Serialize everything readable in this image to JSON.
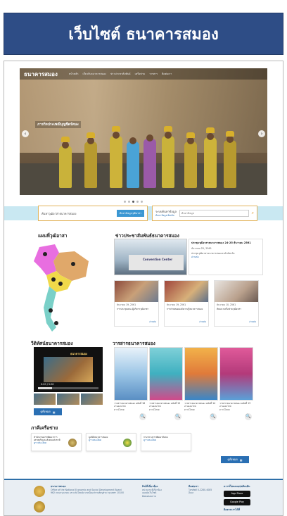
{
  "page_title": "เว็บไซต์ ธนาคารสมอง",
  "site": {
    "logo": "ธนาคารสมอง",
    "nav": [
      "หน้าหลัก",
      "เกี่ยวกับธนาคารสมอง",
      "ข่าวประชาสัมพันธ์",
      "เครือข่าย",
      "วารสาร",
      "ติดต่อเรา"
    ]
  },
  "hero": {
    "caption": "ภารกิจประเพณีบุญซีดรัตนะ",
    "prev": "‹",
    "next": "›"
  },
  "search": {
    "expert_label": "ค้นหาวุฒิอาสาธนาคารสมอง",
    "expert_button": "ค้นหาข้อมูลวุฒิอาสา",
    "db_label": "ระบบค้นหาข้อมูล",
    "db_link": "ค้นหาข้อมูลเพิ่มเติม",
    "db_placeholder": "ค้นหาข้อมูล"
  },
  "sections": {
    "map": "แผนที่วุฒิอาสา",
    "news": "ข่าวประชาสัมพันธ์ธนาคารสมอง",
    "video": "วีดิทัศน์ธนาคารสมอง",
    "journal": "วารสารธนาคารสมอง",
    "partners": "ภาคีเครือข่าย"
  },
  "news": {
    "main": {
      "title": "ประชุมวุฒิอาสาธนาคารสมอง 24-25 ธันวาคม 2561",
      "date": "ธันวาคม 25, 2561",
      "summary": "ประชุมวุฒิอาสาธนาคารสมองระดับจังหวัด",
      "more": "อ่านต่อ"
    },
    "items": [
      {
        "date": "ธันวาคม 19, 2561",
        "title": "การประชุมคณะผู้บริหารวุฒิอาสา",
        "more": "อ่านต่อ"
      },
      {
        "date": "ธันวาคม 19, 2561",
        "title": "การถ่ายทอดองค์ความรู้ธนาคารสมอง",
        "more": "อ่านต่อ"
      },
      {
        "date": "ธันวาคม 10, 2561",
        "title": "สัมมนาเครือข่ายวุฒิอาสา",
        "more": "อ่านต่อ"
      }
    ]
  },
  "video": {
    "overlay": "ธนาคารสมอง",
    "time": "0:00 / 5:00",
    "more": "ดูทั้งหมด"
  },
  "journals": [
    {
      "title": "วารสารธนาคารสมอง ฉบับที่ 16",
      "views": "อ่านออนไลน์",
      "download": "ดาวน์โหลด",
      "zoom": "🔍"
    },
    {
      "title": "วารสารธนาคารสมอง ฉบับที่ 15",
      "views": "อ่านออนไลน์",
      "download": "ดาวน์โหลด",
      "zoom": "🔍"
    },
    {
      "title": "วารสารธนาคารสมอง ฉบับที่ 14",
      "views": "อ่านออนไลน์",
      "download": "ดาวน์โหลด",
      "zoom": "🔍"
    },
    {
      "title": "วารสารธนาคารสมอง ฉบับที่ 13",
      "views": "อ่านออนไลน์",
      "download": "ดาวน์โหลด",
      "zoom": "🔍"
    }
  ],
  "partners": [
    {
      "title": "สำนักงานสภาพัฒนาการเศรษฐกิจและสังคมแห่งชาติ",
      "link": "ดูรายละเอียด"
    },
    {
      "title": "มูลนิธิธนาคารสมอง",
      "link": "ดูรายละเอียด"
    },
    {
      "title": "กระทรวงการพัฒนาสังคม",
      "link": "ดูรายละเอียด"
    }
  ],
  "partners_more": "ดูทั้งหมด",
  "footer": {
    "org_title": "ธนาคารสมอง",
    "org_sub": "Office of the National Economic and Social Development Board",
    "org_addr": "962 ถนนกรุงเกษม แขวงวัดโสมนัส เขตป้อมปราบศัตรูพ่าย กรุงเทพฯ 10100",
    "links_title": "ลิงก์ที่เกี่ยวข้อง",
    "links": [
      "หน่วยงานที่เกี่ยวข้อง",
      "แผนผังเว็บไซต์",
      "ติดต่อสอบถาม"
    ],
    "contact_title": "ติดต่อเรา",
    "contact": [
      "โทรศัพท์ 0-2280-4085",
      "อีเมล"
    ],
    "app_title": "ดาวน์โหลดแอปพลิเคชัน",
    "app_store": "App Store",
    "google_play": "Google Play",
    "social_title": "ติดตามเราได้ที่"
  }
}
